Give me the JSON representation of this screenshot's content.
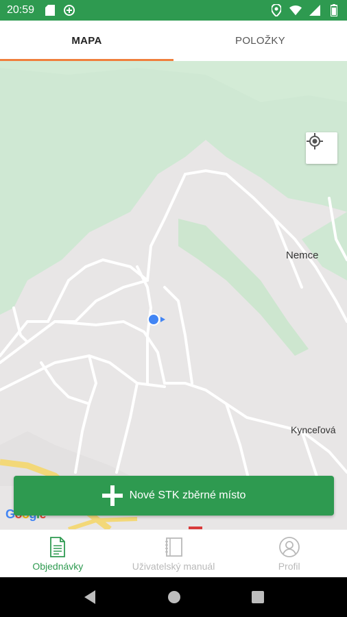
{
  "status_bar": {
    "time": "20:59",
    "bg_color": "#2e9a50",
    "left_icons": [
      "sd-card-icon",
      "data-saver-icon"
    ],
    "right_icons": [
      "location-icon",
      "wifi-icon",
      "signal-icon",
      "battery-icon"
    ]
  },
  "tabs": [
    {
      "label": "MAPA",
      "active": true
    },
    {
      "label": "POLOŽKY",
      "active": false
    }
  ],
  "map": {
    "labels": {
      "place1": "Nemce",
      "place2": "Kynceľová"
    },
    "attribution": "Google",
    "locate_icon": "my-location-icon"
  },
  "action_button": {
    "label": "Nové STK zběrné místo",
    "icon": "plus-icon"
  },
  "bottom_nav": [
    {
      "label": "Objednávky",
      "icon": "document-icon",
      "active": true
    },
    {
      "label": "Uživatelský manuál",
      "icon": "manual-icon",
      "active": false
    },
    {
      "label": "Profil",
      "icon": "profile-icon",
      "active": false
    }
  ],
  "colors": {
    "primary": "#2e9a50",
    "accent": "#f07f3c"
  }
}
